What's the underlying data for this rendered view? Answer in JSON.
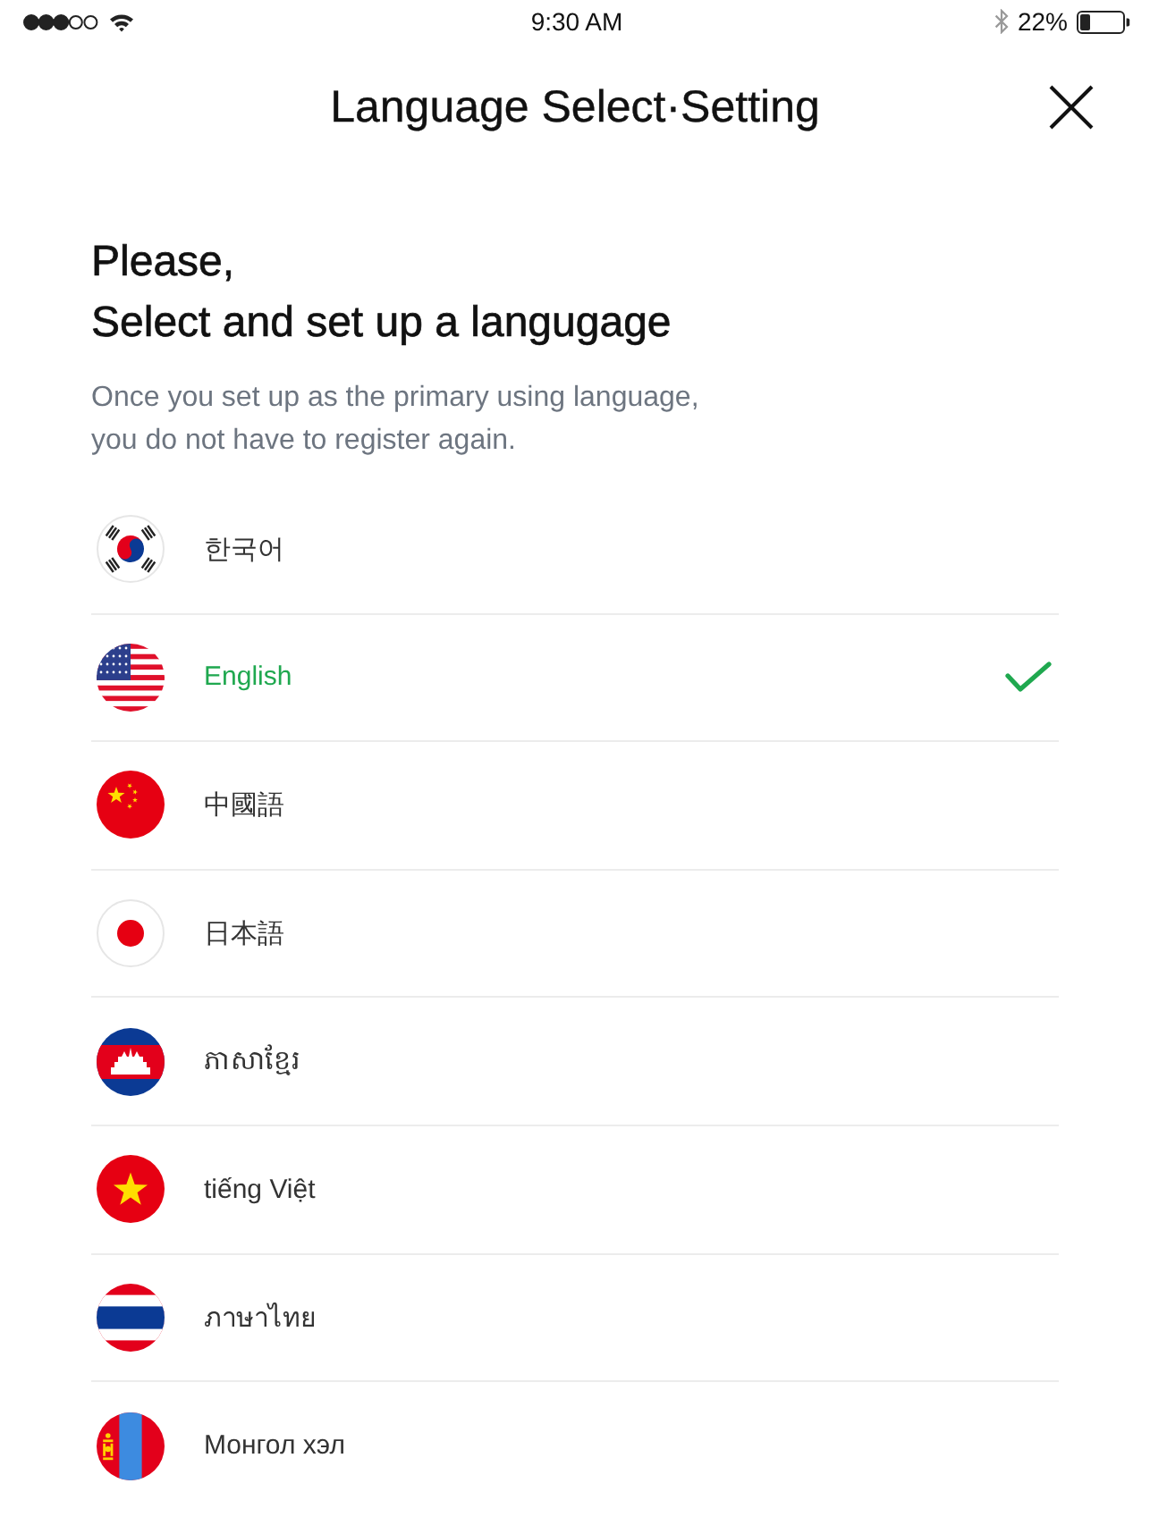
{
  "status_bar": {
    "time": "9:30 AM",
    "battery": "22%"
  },
  "header": {
    "title": "Language Select·Setting"
  },
  "intro": {
    "heading_lines": [
      "Please,",
      "Select and set up a langugage"
    ],
    "description_lines": [
      "Once you set up as the primary using language,",
      "you do not have to register again."
    ]
  },
  "languages": [
    {
      "label": "한국어",
      "kind": "korea",
      "selected": false
    },
    {
      "label": "English",
      "kind": "usa",
      "selected": true
    },
    {
      "label": "中國語",
      "kind": "china",
      "selected": false
    },
    {
      "label": "日本語",
      "kind": "japan",
      "selected": false
    },
    {
      "label": "ភាសាខ្មែរ",
      "kind": "cambodia",
      "selected": false
    },
    {
      "label": "tiếng Việt",
      "kind": "vietnam",
      "selected": false
    },
    {
      "label": "ภาษาไทย",
      "kind": "thailand",
      "selected": false
    },
    {
      "label": "Монгол хэл",
      "kind": "mongolia",
      "selected": false
    }
  ]
}
